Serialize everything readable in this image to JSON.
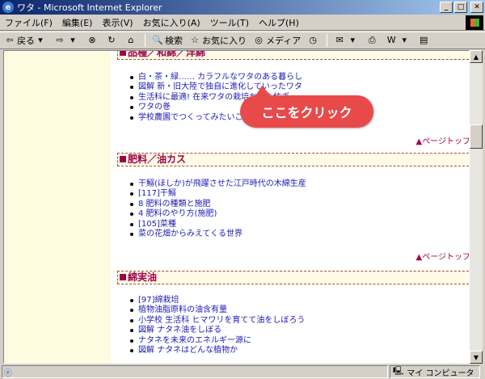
{
  "window": {
    "title": "ワタ - Microsoft Internet Explorer"
  },
  "menu": [
    "ファイル(F)",
    "編集(E)",
    "表示(V)",
    "お気に入り(A)",
    "ツール(T)",
    "ヘルプ(H)"
  ],
  "toolbar": {
    "back": "戻る",
    "search": "検索",
    "favorites": "お気に入り",
    "media": "メディア"
  },
  "sections": [
    {
      "title": "品種／和綿／洋綿",
      "links": [
        "白・茶・緑…… カラフルなワタのある暮らし",
        "図解 新・旧大陸で独自に進化していったワタ",
        "生活科に最適! 在来ワタの栽培から糸紡ぎ",
        "ワタの巻",
        "学校農園でつくってみたいこんな野菜"
      ]
    },
    {
      "title": "肥料／油カス",
      "links": [
        "干鰯(ほしか)が飛躍させた江戸時代の木綿生産",
        "[117]干鰯",
        "8 肥料の種類と施肥",
        "4 肥料のやり方(施肥)",
        "[105]菜種",
        "菜の花畑からみえてくる世界"
      ]
    },
    {
      "title": "綿実油",
      "links": [
        "[97]綿栽培",
        "植物油脂原料の油含有量",
        "小学校 生活科 ヒマワリを育てて油をしぼろう",
        "図解 ナタネ油をしぼる",
        "ナタネを未来のエネルギー源に",
        "図解 ナタネはどんな植物か"
      ]
    }
  ],
  "pagetop": "▲ページトップ",
  "callout": "ここをクリック",
  "status": {
    "zone": "マイ コンピュータ"
  }
}
